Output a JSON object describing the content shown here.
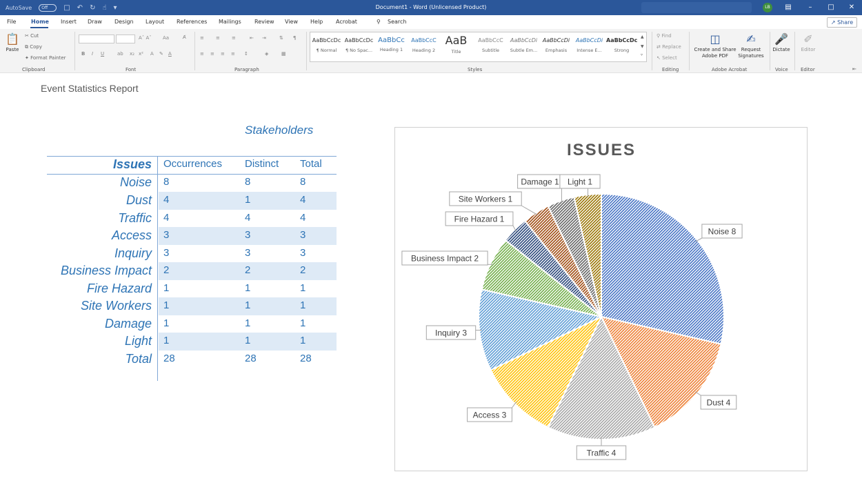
{
  "titlebar": {
    "autosave_label": "AutoSave",
    "autosave_state": "Off",
    "doc_title": "Document1 - Word (Unlicensed Product)",
    "avatar_initials": "LB"
  },
  "menu": {
    "items": [
      "File",
      "Home",
      "Insert",
      "Draw",
      "Design",
      "Layout",
      "References",
      "Mailings",
      "Review",
      "View",
      "Help",
      "Acrobat"
    ],
    "search_label": "Search",
    "share_label": "Share"
  },
  "ribbon": {
    "clipboard": {
      "paste": "Paste",
      "cut": "Cut",
      "copy": "Copy",
      "format_painter": "Format Painter",
      "label": "Clipboard"
    },
    "font": {
      "label": "Font"
    },
    "paragraph": {
      "label": "Paragraph"
    },
    "styles": {
      "label": "Styles",
      "tiles": [
        {
          "sample": "AaBbCcDc",
          "name": "¶ Normal"
        },
        {
          "sample": "AaBbCcDc",
          "name": "¶ No Spac..."
        },
        {
          "sample": "AaBbCc",
          "name": "Heading 1"
        },
        {
          "sample": "AaBbCcC",
          "name": "Heading 2"
        },
        {
          "sample": "AaB",
          "name": "Title"
        },
        {
          "sample": "AaBbCcC",
          "name": "Subtitle"
        },
        {
          "sample": "AaBbCcDi",
          "name": "Subtle Em..."
        },
        {
          "sample": "AaBbCcDi",
          "name": "Emphasis"
        },
        {
          "sample": "AaBbCcDi",
          "name": "Intense E..."
        },
        {
          "sample": "AaBbCcDc",
          "name": "Strong"
        }
      ]
    },
    "editing": {
      "find": "Find",
      "replace": "Replace",
      "select": "Select",
      "label": "Editing"
    },
    "acrobat": {
      "create_share": "Create and Share Adobe PDF",
      "request_signatures": "Request Signatures",
      "label": "Adobe Acrobat"
    },
    "voice": {
      "dictate": "Dictate",
      "label": "Voice"
    },
    "editor": {
      "editor": "Editor",
      "label": "Editor"
    }
  },
  "document": {
    "title": "Event Statistics Report",
    "table": {
      "caption": "Stakeholders",
      "headers": [
        "Issues",
        "Occurrences",
        "Distinct",
        "Total"
      ],
      "rows": [
        [
          "Noise",
          "8",
          "8",
          "8"
        ],
        [
          "Dust",
          "4",
          "1",
          "4"
        ],
        [
          "Traffic",
          "4",
          "4",
          "4"
        ],
        [
          "Access",
          "3",
          "3",
          "3"
        ],
        [
          "Inquiry",
          "3",
          "3",
          "3"
        ],
        [
          "Business Impact",
          "2",
          "2",
          "2"
        ],
        [
          "Fire Hazard",
          "1",
          "1",
          "1"
        ],
        [
          "Site Workers",
          "1",
          "1",
          "1"
        ],
        [
          "Damage",
          "1",
          "1",
          "1"
        ],
        [
          "Light",
          "1",
          "1",
          "1"
        ],
        [
          "Total",
          "28",
          "28",
          "28"
        ]
      ]
    }
  },
  "chart_data": {
    "type": "pie",
    "title": "ISSUES",
    "categories": [
      "Noise",
      "Dust",
      "Traffic",
      "Access",
      "Inquiry",
      "Business Impact",
      "Fire Hazard",
      "Site Workers",
      "Damage",
      "Light"
    ],
    "values": [
      8,
      4,
      4,
      3,
      3,
      2,
      1,
      1,
      1,
      1
    ],
    "data_labels": [
      "Noise 8",
      "Dust 4",
      "Traffic 4",
      "Access 3",
      "Inquiry 3",
      "Business Impact 2",
      "Fire Hazard 1",
      "Site Workers 1",
      "Damage 1",
      "Light 1"
    ],
    "colors": [
      "#4472c4",
      "#ed7d31",
      "#a5a5a5",
      "#ffc000",
      "#5b9bd5",
      "#70ad47",
      "#264478",
      "#9e480e",
      "#636363",
      "#997300"
    ],
    "legend": "none"
  }
}
